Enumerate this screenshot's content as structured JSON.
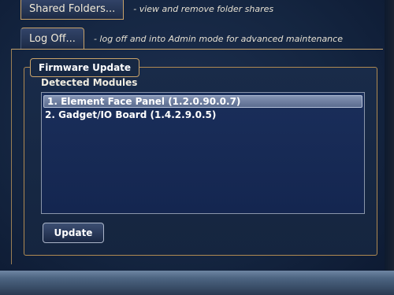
{
  "menu": {
    "shared_folders": {
      "label": "Shared Folders...",
      "description": "- view and remove folder shares"
    },
    "log_off": {
      "label": "Log Off...",
      "description": "- log off and into Admin mode for advanced maintenance"
    }
  },
  "firmware": {
    "title": "Firmware Update",
    "section_label": "Detected Modules",
    "modules": [
      "1. Element Face Panel (1.2.0.90.0.7)",
      "2. Gadget/IO Board (1.4.2.9.0.5)"
    ],
    "selected_index": 0,
    "update_label": "Update"
  },
  "colors": {
    "accent_border": "#c9a36a",
    "list_background": "#1a2e5a",
    "selection_highlight": "#8393b3"
  }
}
